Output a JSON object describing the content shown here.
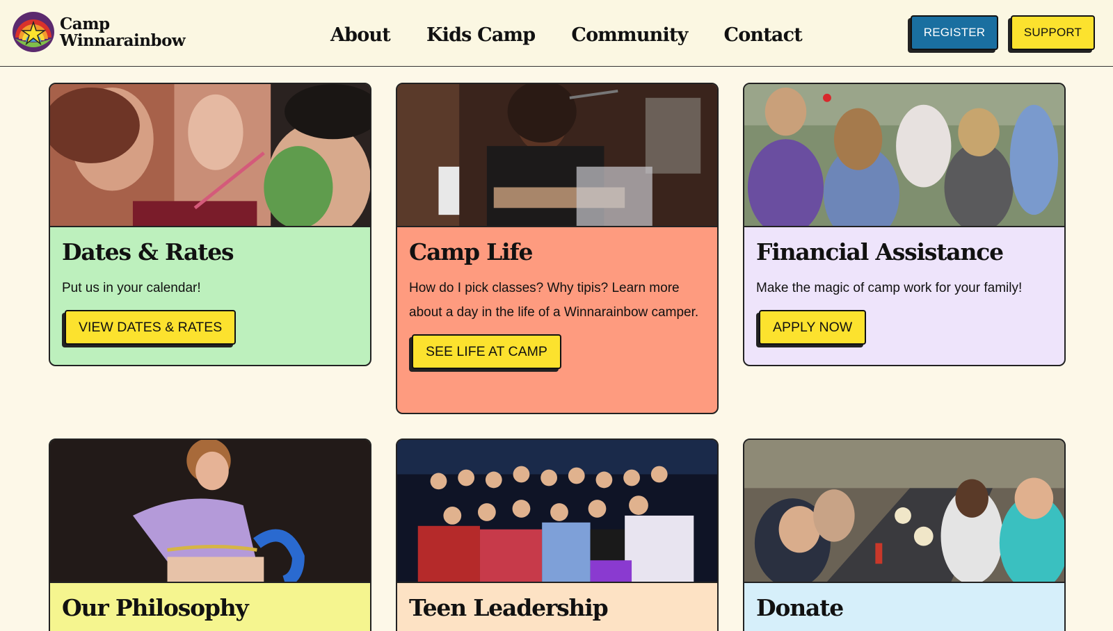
{
  "header": {
    "logo_line1": "Camp",
    "logo_line2": "Winnarainbow",
    "logo_icon": "rainbow-star-icon",
    "nav": [
      "About",
      "Kids Camp",
      "Community",
      "Contact"
    ],
    "register_label": "REGISTER",
    "support_label": "SUPPORT"
  },
  "cards": [
    {
      "title": "Dates & Rates",
      "text": "Put us in your calendar!",
      "button": "VIEW DATES & RATES",
      "color": "#bdf0bd",
      "photo": "face-painting-photo"
    },
    {
      "title": "Camp Life",
      "text": "How do I pick classes? Why tipis? Learn more about a day in the life of a Winnarainbow camper.",
      "button": "SEE LIFE AT CAMP",
      "color": "#fe9b7f",
      "photo": "ukulele-performer-photo"
    },
    {
      "title": "Financial Assistance",
      "text": "Make the magic of camp work for your family!",
      "button": "APPLY NOW",
      "color": "#eee4fb",
      "photo": "kids-circle-photo"
    },
    {
      "title": "Our Philosophy",
      "color": "#f5f58f",
      "photo": "dancing-child-photo"
    },
    {
      "title": "Teen Leadership",
      "color": "#fde2c4",
      "photo": "teen-group-photo"
    },
    {
      "title": "Donate",
      "color": "#d6effa",
      "photo": "dinner-table-photo"
    }
  ],
  "colors": {
    "background": "#fdf8e8",
    "register": "#1a6fa0",
    "support": "#fce22e",
    "button": "#fce22e"
  }
}
